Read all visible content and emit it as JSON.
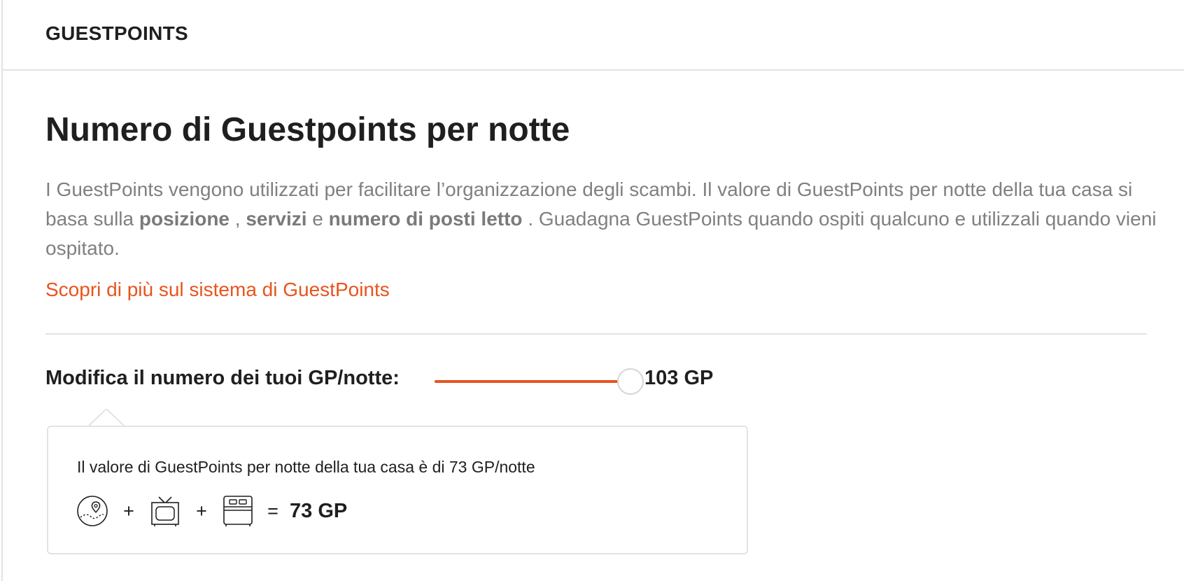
{
  "header": {
    "title": "GUESTPOINTS"
  },
  "main": {
    "heading": "Numero di Guestpoints per notte",
    "description": {
      "part1": "I GuestPoints vengono utilizzati per facilitare l’organizzazione degli scambi. Il valore di GuestPoints per notte della tua casa si basa sulla",
      "bold1": "posizione",
      "sep1": " , ",
      "bold2": "servizi",
      "sep2": " e ",
      "bold3": "numero di posti letto",
      "part2": " . Guadagna GuestPoints quando ospiti qualcuno e utilizzali quando vieni ospitato."
    },
    "learn_more_link": "Scopri di più sul sistema di GuestPoints"
  },
  "slider": {
    "label": "Modifica il numero dei tuoi GP/notte:",
    "value_label": "103 GP",
    "value": 103,
    "fraction": 1.0,
    "accent_color": "#e8541e"
  },
  "info": {
    "text": "Il valore di GuestPoints per notte della tua casa è di 73 GP/notte",
    "formula": {
      "icons": [
        "location-icon",
        "tv-icon",
        "bed-icon"
      ],
      "plus": "+",
      "equals": "=",
      "total": "73 GP"
    }
  },
  "colors": {
    "accent": "#e8541e",
    "text": "#1f1f1f",
    "muted_text": "#808080",
    "border": "#e3e3e3"
  }
}
